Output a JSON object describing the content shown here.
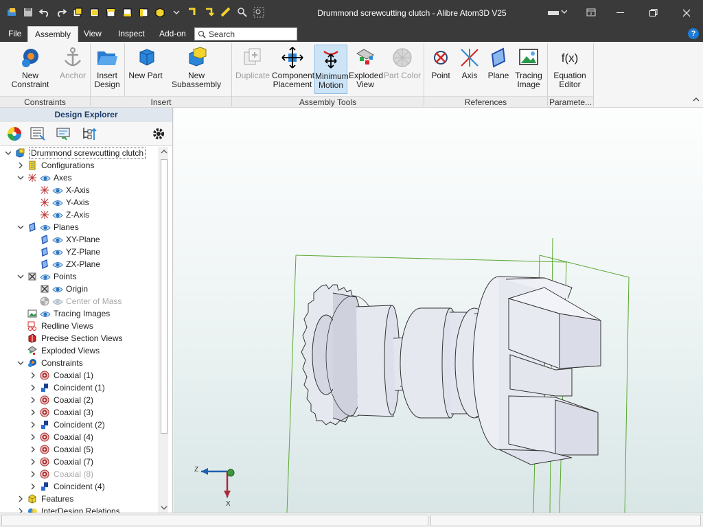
{
  "app": {
    "title": "Drummond screwcutting clutch - Alibre Atom3D V25"
  },
  "menu": {
    "tabs": [
      {
        "label": "File",
        "active": false
      },
      {
        "label": "Assembly",
        "active": true
      },
      {
        "label": "View",
        "active": false
      },
      {
        "label": "Inspect",
        "active": false
      },
      {
        "label": "Add-on",
        "active": false
      }
    ],
    "search_placeholder": "Search"
  },
  "ribbon": {
    "buttons": [
      {
        "label": "New Constraint",
        "icon": "new-constraint-icon",
        "state": "normal"
      },
      {
        "label": "Anchor",
        "icon": "anchor-icon",
        "state": "disabled"
      },
      {
        "label": "Insert Design",
        "icon": "folder-open-icon",
        "state": "normal"
      },
      {
        "label": "New Part",
        "icon": "new-part-icon",
        "state": "normal"
      },
      {
        "label": "New Subassembly",
        "icon": "new-subassembly-icon",
        "state": "normal"
      },
      {
        "label": "Duplicate",
        "icon": "duplicate-icon",
        "state": "disabled"
      },
      {
        "label": "Component Placement",
        "icon": "component-placement-icon",
        "state": "normal"
      },
      {
        "label": "Minimum Motion",
        "icon": "minimum-motion-icon",
        "state": "active"
      },
      {
        "label": "Exploded View",
        "icon": "exploded-view-icon",
        "state": "normal"
      },
      {
        "label": "Part Color",
        "icon": "part-color-icon",
        "state": "disabled"
      },
      {
        "label": "Point",
        "icon": "point-icon",
        "state": "normal"
      },
      {
        "label": "Axis",
        "icon": "axis-icon",
        "state": "normal"
      },
      {
        "label": "Plane",
        "icon": "plane-icon",
        "state": "normal"
      },
      {
        "label": "Tracing Image",
        "icon": "tracing-image-icon",
        "state": "normal"
      },
      {
        "label": "Equation Editor",
        "icon": "equation-editor-icon",
        "state": "normal",
        "glyph": "f(x)"
      }
    ],
    "groups": [
      "Constraints",
      "Insert",
      "Assembly Tools",
      "References",
      "Paramete..."
    ]
  },
  "explorer": {
    "title": "Design Explorer",
    "tree": [
      {
        "label": "Drummond screwcutting clutch",
        "level": 0,
        "icon": "assembly-icon",
        "expander": "open",
        "selected": true
      },
      {
        "label": "Configurations",
        "level": 1,
        "icon": "configurations-icon",
        "expander": "closed"
      },
      {
        "label": "Axes",
        "level": 1,
        "icon": "axes-icon",
        "expander": "open",
        "eye": true
      },
      {
        "label": "X-Axis",
        "level": 2,
        "icon": "axis-item-icon",
        "eye": true
      },
      {
        "label": "Y-Axis",
        "level": 2,
        "icon": "axis-item-icon",
        "eye": true
      },
      {
        "label": "Z-Axis",
        "level": 2,
        "icon": "axis-item-icon",
        "eye": true
      },
      {
        "label": "Planes",
        "level": 1,
        "icon": "planes-icon",
        "expander": "open",
        "eye": true
      },
      {
        "label": "XY-Plane",
        "level": 2,
        "icon": "plane-item-icon",
        "eye": true
      },
      {
        "label": "YZ-Plane",
        "level": 2,
        "icon": "plane-item-icon",
        "eye": true
      },
      {
        "label": "ZX-Plane",
        "level": 2,
        "icon": "plane-item-icon",
        "eye": true
      },
      {
        "label": "Points",
        "level": 1,
        "icon": "points-icon",
        "expander": "open",
        "eye": true
      },
      {
        "label": "Origin",
        "level": 2,
        "icon": "point-item-icon",
        "eye": true
      },
      {
        "label": "Center of Mass",
        "level": 2,
        "icon": "center-of-mass-icon",
        "eye": true,
        "dim": true
      },
      {
        "label": "Tracing Images",
        "level": 1,
        "icon": "tracing-images-icon",
        "eye": true
      },
      {
        "label": "Redline Views",
        "level": 1,
        "icon": "redline-views-icon"
      },
      {
        "label": "Precise Section Views",
        "level": 1,
        "icon": "section-views-icon"
      },
      {
        "label": "Exploded Views",
        "level": 1,
        "icon": "exploded-views-icon"
      },
      {
        "label": "Constraints",
        "level": 1,
        "icon": "constraints-icon",
        "expander": "open"
      },
      {
        "label": "Coaxial (1)",
        "level": 2,
        "icon": "coaxial-icon",
        "expander": "closed"
      },
      {
        "label": "Coincident (1)",
        "level": 2,
        "icon": "coincident-icon",
        "expander": "closed"
      },
      {
        "label": "Coaxial (2)",
        "level": 2,
        "icon": "coaxial-icon",
        "expander": "closed"
      },
      {
        "label": "Coaxial (3)",
        "level": 2,
        "icon": "coaxial-icon",
        "expander": "closed"
      },
      {
        "label": "Coincident (2)",
        "level": 2,
        "icon": "coincident-icon",
        "expander": "closed"
      },
      {
        "label": "Coaxial (4)",
        "level": 2,
        "icon": "coaxial-icon",
        "expander": "closed"
      },
      {
        "label": "Coaxial (5)",
        "level": 2,
        "icon": "coaxial-icon",
        "expander": "closed"
      },
      {
        "label": "Coaxial (7)",
        "level": 2,
        "icon": "coaxial-icon",
        "expander": "closed"
      },
      {
        "label": "Coaxial (8)",
        "level": 2,
        "icon": "coaxial-icon",
        "expander": "closed",
        "dim": true
      },
      {
        "label": "Coincident (4)",
        "level": 2,
        "icon": "coincident-icon",
        "expander": "closed"
      },
      {
        "label": "Features",
        "level": 1,
        "icon": "features-icon",
        "expander": "closed"
      },
      {
        "label": "InterDesign Relations",
        "level": 1,
        "icon": "interdesign-icon",
        "expander": "closed"
      }
    ]
  },
  "triad": {
    "z_label": "Z",
    "x_label": "X"
  },
  "colors": {
    "titlebar": "#3a3a3a",
    "accent": "#1e7ad4",
    "bbox_green": "#5aa832",
    "part_fill": "#e4e6ee"
  }
}
